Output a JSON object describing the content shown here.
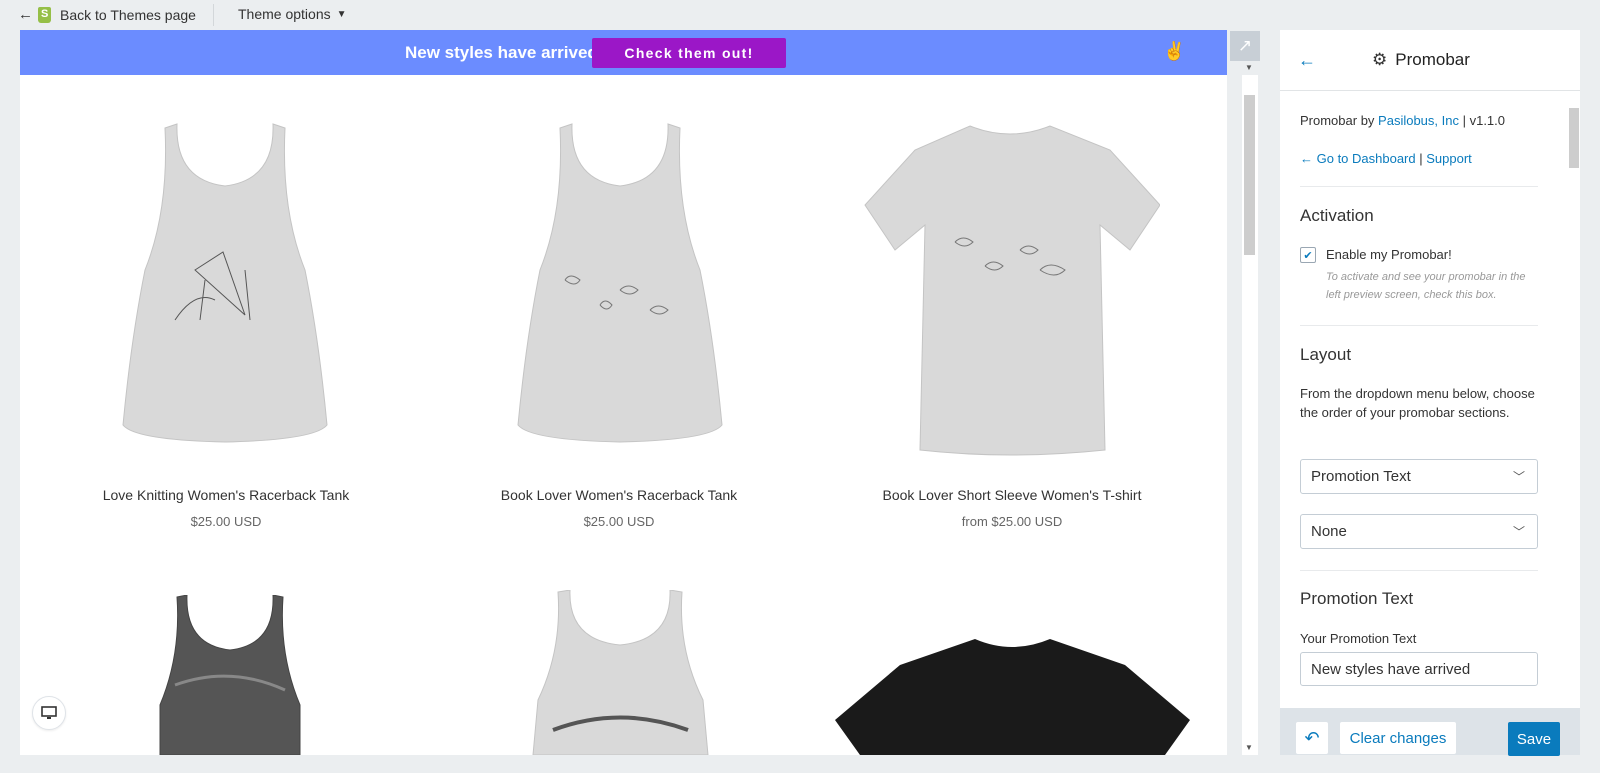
{
  "topbar": {
    "back_label": "Back to Themes page",
    "theme_options_label": "Theme options"
  },
  "promobar": {
    "text": "New styles have arrived",
    "button_label": "Check them out!",
    "bg_color": "#6b8cff",
    "button_color": "#9b17c7",
    "icon": "peace-hand-icon"
  },
  "products": [
    {
      "name": "Love Knitting Women's Racerback Tank",
      "price": "$25.00 USD",
      "image": "gray-racerback-tank"
    },
    {
      "name": "Book Lover Women's Racerback Tank",
      "price": "$25.00 USD",
      "image": "gray-racerback-tank"
    },
    {
      "name": "Book Lover Short Sleeve Women's T-shirt",
      "price": "from $25.00 USD",
      "image": "gray-tshirt"
    },
    {
      "name": "",
      "price": "",
      "image": "dark-gray-tank"
    },
    {
      "name": "",
      "price": "",
      "image": "gray-racerback-tank"
    },
    {
      "name": "",
      "price": "",
      "image": "black-tshirt"
    }
  ],
  "panel": {
    "title": "Promobar",
    "byline_prefix": "Promobar by ",
    "byline_link": "Pasilobus, Inc",
    "byline_suffix": " | v1.1.0",
    "dashboard_link": "← Go to Dashboard",
    "separator": " | ",
    "support_link": "Support",
    "activation": {
      "heading": "Activation",
      "checkbox_label": "Enable my Promobar!",
      "checked": true,
      "note": "To activate and see your promobar in the left preview screen, check this box."
    },
    "layout": {
      "heading": "Layout",
      "description": "From the dropdown menu below, choose the order of your promobar sections.",
      "select1": "Promotion Text",
      "select2": "None"
    },
    "promotion": {
      "heading": "Promotion Text",
      "field_label": "Your Promotion Text",
      "field_value": "New styles have arrived"
    }
  },
  "footer": {
    "clear_label": "Clear changes",
    "save_label": "Save",
    "accent": "#0a7bbd"
  }
}
